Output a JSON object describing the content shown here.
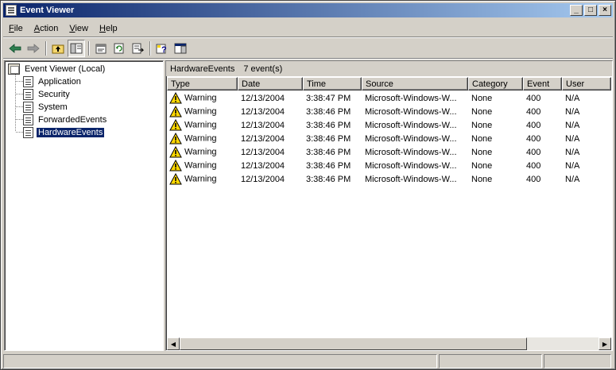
{
  "window": {
    "title": "Event Viewer",
    "controls": {
      "minimize": "_",
      "maximize": "□",
      "close": "×"
    }
  },
  "menu": [
    {
      "label": "File",
      "accel": "F",
      "rest": "ile"
    },
    {
      "label": "Action",
      "accel": "A",
      "rest": "ction"
    },
    {
      "label": "View",
      "accel": "V",
      "rest": "iew"
    },
    {
      "label": "Help",
      "accel": "H",
      "rest": "elp"
    }
  ],
  "toolbar": {
    "back_icon": "back-arrow-icon",
    "forward_icon": "forward-arrow-icon",
    "up_icon": "up-folder-icon",
    "show_hide_tree_icon": "show-hide-tree-icon",
    "properties_icon": "properties-icon",
    "refresh_icon": "refresh-icon",
    "export_icon": "export-list-icon",
    "help_icon": "help-icon",
    "show_hide_action_pane_icon": "action-pane-icon"
  },
  "tree": {
    "root": "Event Viewer (Local)",
    "items": [
      {
        "label": "Application"
      },
      {
        "label": "Security"
      },
      {
        "label": "System"
      },
      {
        "label": "ForwardedEvents"
      },
      {
        "label": "HardwareEvents",
        "selected": true
      }
    ]
  },
  "list": {
    "log_name": "HardwareEvents",
    "event_count": "7 event(s)",
    "columns": [
      "Type",
      "Date",
      "Time",
      "Source",
      "Category",
      "Event",
      "User"
    ],
    "rows": [
      {
        "type": "Warning",
        "date": "12/13/2004",
        "time": "3:38:47 PM",
        "source": "Microsoft-Windows-W...",
        "category": "None",
        "event": "400",
        "user": "N/A"
      },
      {
        "type": "Warning",
        "date": "12/13/2004",
        "time": "3:38:46 PM",
        "source": "Microsoft-Windows-W...",
        "category": "None",
        "event": "400",
        "user": "N/A"
      },
      {
        "type": "Warning",
        "date": "12/13/2004",
        "time": "3:38:46 PM",
        "source": "Microsoft-Windows-W...",
        "category": "None",
        "event": "400",
        "user": "N/A"
      },
      {
        "type": "Warning",
        "date": "12/13/2004",
        "time": "3:38:46 PM",
        "source": "Microsoft-Windows-W...",
        "category": "None",
        "event": "400",
        "user": "N/A"
      },
      {
        "type": "Warning",
        "date": "12/13/2004",
        "time": "3:38:46 PM",
        "source": "Microsoft-Windows-W...",
        "category": "None",
        "event": "400",
        "user": "N/A"
      },
      {
        "type": "Warning",
        "date": "12/13/2004",
        "time": "3:38:46 PM",
        "source": "Microsoft-Windows-W...",
        "category": "None",
        "event": "400",
        "user": "N/A"
      },
      {
        "type": "Warning",
        "date": "12/13/2004",
        "time": "3:38:46 PM",
        "source": "Microsoft-Windows-W...",
        "category": "None",
        "event": "400",
        "user": "N/A"
      }
    ]
  },
  "colors": {
    "title_bar_start": "#0a246a",
    "title_bar_end": "#a6caf0",
    "selection": "#0a246a",
    "warning_yellow": "#ffd800"
  }
}
